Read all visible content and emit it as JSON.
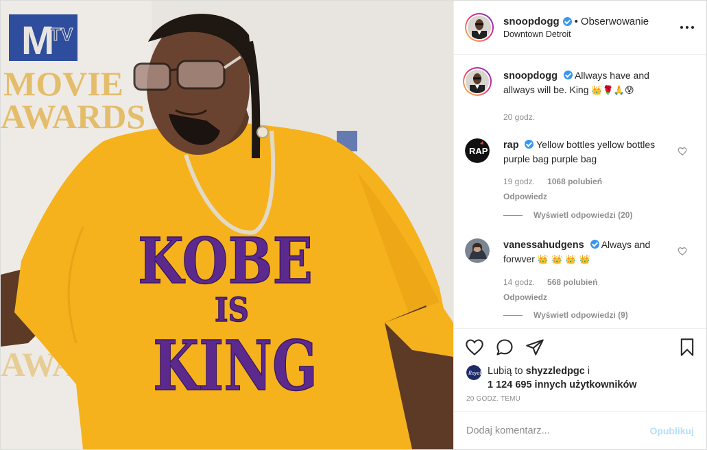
{
  "header": {
    "username": "snoopdogg",
    "separator": "•",
    "follow_label": "Obserwowanie",
    "location": "Downtown Detroit",
    "more_icon": "more-horizontal-icon"
  },
  "caption": {
    "username": "snoopdogg",
    "text": "Allways have and allways will be. King",
    "emojis": "👑🌹🙏😰",
    "time": "20 godz."
  },
  "comments": [
    {
      "username": "rap",
      "text": "Yellow bottles yellow bottles purple bag purple bag",
      "time": "19 godz.",
      "likes": "1068 polubień",
      "reply_label": "Odpowiedz",
      "view_replies": "Wyświetl odpowiedzi (20)"
    },
    {
      "username": "vanessahudgens",
      "text": "Always and forwver",
      "emojis": "👑 👑 👑 👑",
      "time": "14 godz.",
      "likes": "568 polubień",
      "reply_label": "Odpowiedz",
      "view_replies": "Wyświetl odpowiedzi (9)"
    }
  ],
  "likes": {
    "prefix": "Lubią to",
    "user": "shyzzledpgc",
    "suffix": "i",
    "others": "1 124 695 innych użytkowników"
  },
  "timestamp": "20 GODZ. TEMU",
  "add_comment": {
    "placeholder": "Dodaj komentarz...",
    "post_label": "Opublikuj"
  },
  "photo": {
    "backdrop_text_top": [
      "MOVIE",
      "AWARDS"
    ],
    "backdrop_logo": "TV",
    "backdrop_text_bottom": "AWARDS",
    "shirt_lines": [
      "KOBE",
      "IS",
      "KING"
    ]
  },
  "colors": {
    "shirt": "#f6b21c",
    "shirt_text": "#5b2a8c",
    "backdrop": "#e9e6e1",
    "mtv_blue": "#2e4d9c",
    "verified": "#3897f0",
    "post_button": "#b2dffc"
  }
}
